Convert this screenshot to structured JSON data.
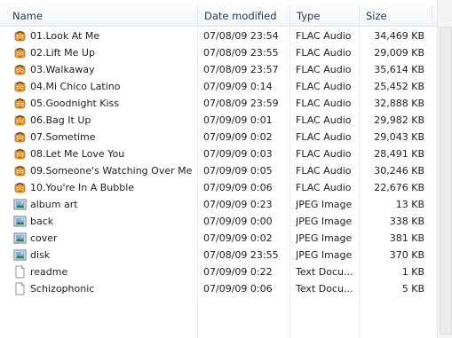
{
  "columns": {
    "name": "Name",
    "date": "Date modified",
    "type": "Type",
    "size": "Size"
  },
  "files": [
    {
      "name": "01.Look At Me",
      "date": "07/08/09 23:54",
      "type": "FLAC Audio",
      "size": "34,469 KB",
      "icon": "flac-audio-icon"
    },
    {
      "name": "02.Lift Me Up",
      "date": "07/08/09 23:55",
      "type": "FLAC Audio",
      "size": "29,009 KB",
      "icon": "flac-audio-icon"
    },
    {
      "name": "03.Walkaway",
      "date": "07/08/09 23:57",
      "type": "FLAC Audio",
      "size": "35,614 KB",
      "icon": "flac-audio-icon"
    },
    {
      "name": "04.Mi Chico Latino",
      "date": "07/09/09 0:14",
      "type": "FLAC Audio",
      "size": "25,452 KB",
      "icon": "flac-audio-icon"
    },
    {
      "name": "05.Goodnight Kiss",
      "date": "07/08/09 23:59",
      "type": "FLAC Audio",
      "size": "32,888 KB",
      "icon": "flac-audio-icon"
    },
    {
      "name": "06.Bag It Up",
      "date": "07/09/09 0:01",
      "type": "FLAC Audio",
      "size": "29,982 KB",
      "icon": "flac-audio-icon"
    },
    {
      "name": "07.Sometime",
      "date": "07/09/09 0:02",
      "type": "FLAC Audio",
      "size": "29,043 KB",
      "icon": "flac-audio-icon"
    },
    {
      "name": "08.Let Me Love You",
      "date": "07/09/09 0:03",
      "type": "FLAC Audio",
      "size": "28,491 KB",
      "icon": "flac-audio-icon"
    },
    {
      "name": "09.Someone's Watching Over Me",
      "date": "07/09/09 0:05",
      "type": "FLAC Audio",
      "size": "30,246 KB",
      "icon": "flac-audio-icon"
    },
    {
      "name": "10.You're In A Bubble",
      "date": "07/09/09 0:06",
      "type": "FLAC Audio",
      "size": "22,676 KB",
      "icon": "flac-audio-icon"
    },
    {
      "name": "album art",
      "date": "07/09/09 0:23",
      "type": "JPEG Image",
      "size": "13 KB",
      "icon": "jpeg-image-icon"
    },
    {
      "name": "back",
      "date": "07/09/09 0:00",
      "type": "JPEG Image",
      "size": "338 KB",
      "icon": "jpeg-image-icon"
    },
    {
      "name": "cover",
      "date": "07/09/09 0:02",
      "type": "JPEG Image",
      "size": "381 KB",
      "icon": "jpeg-image-icon"
    },
    {
      "name": "disk",
      "date": "07/08/09 23:55",
      "type": "JPEG Image",
      "size": "370 KB",
      "icon": "jpeg-image-icon"
    },
    {
      "name": "readme",
      "date": "07/09/09 0:22",
      "type": "Text Docu...",
      "size": "1 KB",
      "icon": "text-document-icon"
    },
    {
      "name": "Schizophonic",
      "date": "07/09/09 0:06",
      "type": "Text Docu...",
      "size": "5 KB",
      "icon": "text-document-icon"
    }
  ]
}
